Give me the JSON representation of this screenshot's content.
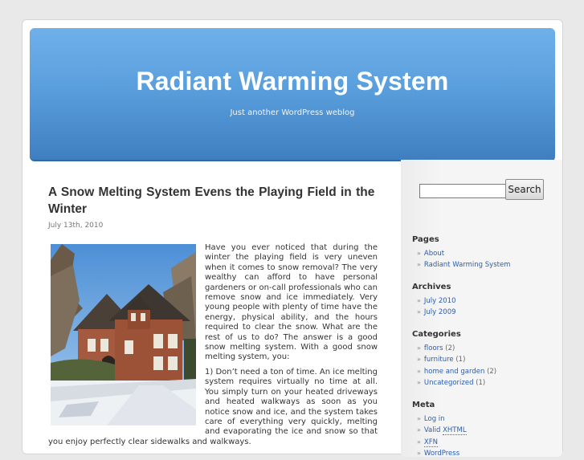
{
  "blog": {
    "title": "Radiant Warming System",
    "description": "Just another WordPress weblog"
  },
  "post": {
    "title": "A Snow Melting System Evens the Playing Field in the Winter",
    "date": "July 13th, 2010",
    "image_alt": "Brick house with snow on the lawn",
    "paragraphs": [
      "Have you ever noticed that during the winter the playing field is very uneven when it comes to snow removal? The very wealthy can afford to have personal gardeners or on-call professionals who can remove snow and ice immediately. Very young people with plenty of time have the energy, physical ability, and the hours required to clear the snow. What are the rest of us to do? The answer is a good snow melting system. With a good snow melting system, you:",
      "1) Don’t need a ton of time. An ice melting system requires virtually no time at all. You simply turn on your heated driveways and heated walkways as soon as you notice snow and ice, and the system takes care of everything very quickly, melting and evaporating the ice and snow so that you enjoy perfectly clear sidewalks and walkways."
    ]
  },
  "search": {
    "button_label": "Search",
    "placeholder": ""
  },
  "sidebar": {
    "pages": {
      "heading": "Pages",
      "items": [
        "About",
        "Radiant Warming System"
      ]
    },
    "archives": {
      "heading": "Archives",
      "items": [
        "July 2010",
        "July 2009"
      ]
    },
    "categories": {
      "heading": "Categories",
      "items": [
        {
          "label": "floors",
          "count": "(2)"
        },
        {
          "label": "furniture",
          "count": "(1)"
        },
        {
          "label": "home and garden",
          "count": "(2)"
        },
        {
          "label": "Uncategorized",
          "count": "(1)"
        }
      ]
    },
    "meta": {
      "heading": "Meta",
      "login": "Log in",
      "valid_prefix": "Valid ",
      "xhtml_abbr": "XHTML",
      "xfn_abbr": "XFN",
      "wordpress": "WordPress"
    }
  },
  "colors": {
    "header_top": "#6fb0ea",
    "header_bottom": "#3f7fc0",
    "link": "#2a5db0"
  },
  "icons": {
    "list_bullet": "»"
  }
}
